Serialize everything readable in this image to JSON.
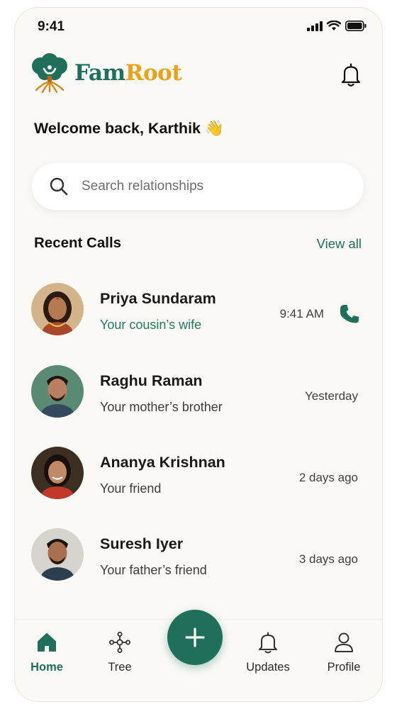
{
  "status_bar": {
    "time": "9:41"
  },
  "app": {
    "name_part1": "Fam",
    "name_part2": "Root"
  },
  "welcome": "Welcome back, Karthik 👋",
  "search": {
    "placeholder": "Search relationships"
  },
  "recent_calls": {
    "title": "Recent Calls",
    "view_all_label": "View all",
    "items": [
      {
        "name": "Priya Sundaram",
        "relationship": "Your cousin’s wife",
        "time": "9:41 AM",
        "highlighted": true
      },
      {
        "name": "Raghu Raman",
        "relationship": "Your mother’s brother",
        "time": "Yesterday",
        "highlighted": false
      },
      {
        "name": "Ananya Krishnan",
        "relationship": "Your friend",
        "time": "2 days ago",
        "highlighted": false
      },
      {
        "name": "Suresh Iyer",
        "relationship": "Your father’s friend",
        "time": "3 days ago",
        "highlighted": false
      }
    ]
  },
  "nav": {
    "items": [
      {
        "label": "Home",
        "icon": "home-icon",
        "active": true
      },
      {
        "label": "Tree",
        "icon": "tree-network-icon",
        "active": false
      },
      {
        "label": "Updates",
        "icon": "bell-icon",
        "active": false
      },
      {
        "label": "Profile",
        "icon": "user-icon",
        "active": false
      }
    ],
    "fab_icon": "plus-icon"
  },
  "colors": {
    "accent": "#1f6f5b",
    "brand_gold": "#e8a21b",
    "background": "#faf9f6"
  }
}
